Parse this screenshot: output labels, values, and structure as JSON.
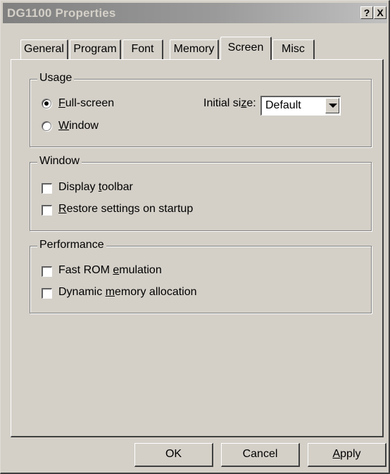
{
  "window": {
    "title": "DG1100 Properties",
    "help_glyph": "?",
    "close_glyph": "X"
  },
  "tabs": [
    {
      "label": "General",
      "active": false
    },
    {
      "label": "Program",
      "active": false
    },
    {
      "label": "Font",
      "active": false
    },
    {
      "label": "Memory",
      "active": false
    },
    {
      "label": "Screen",
      "active": true
    },
    {
      "label": "Misc",
      "active": false
    }
  ],
  "usage": {
    "legend": "Usage",
    "fullscreen": {
      "prefix": "",
      "mnemonic": "F",
      "rest": "ull-screen",
      "checked": true
    },
    "window": {
      "prefix": "",
      "mnemonic": "W",
      "rest": "indow",
      "checked": false
    },
    "initial_size": {
      "prefix": "Initial si",
      "mnemonic": "z",
      "rest": "e:",
      "value": "Default"
    }
  },
  "window_group": {
    "legend": "Window",
    "display_toolbar": {
      "prefix": "Display ",
      "mnemonic": "t",
      "rest": "oolbar",
      "checked": false
    },
    "restore_settings": {
      "prefix": "",
      "mnemonic": "R",
      "rest": "estore settings on startup",
      "checked": false
    }
  },
  "performance": {
    "legend": "Performance",
    "fast_rom": {
      "prefix": "Fast ROM ",
      "mnemonic": "e",
      "rest": "mulation",
      "checked": false
    },
    "dynamic_memory": {
      "prefix": "Dynamic ",
      "mnemonic": "m",
      "rest": "emory allocation",
      "checked": false
    }
  },
  "buttons": {
    "ok": "OK",
    "cancel": "Cancel",
    "apply": {
      "prefix": "",
      "mnemonic": "A",
      "rest": "pply"
    }
  }
}
